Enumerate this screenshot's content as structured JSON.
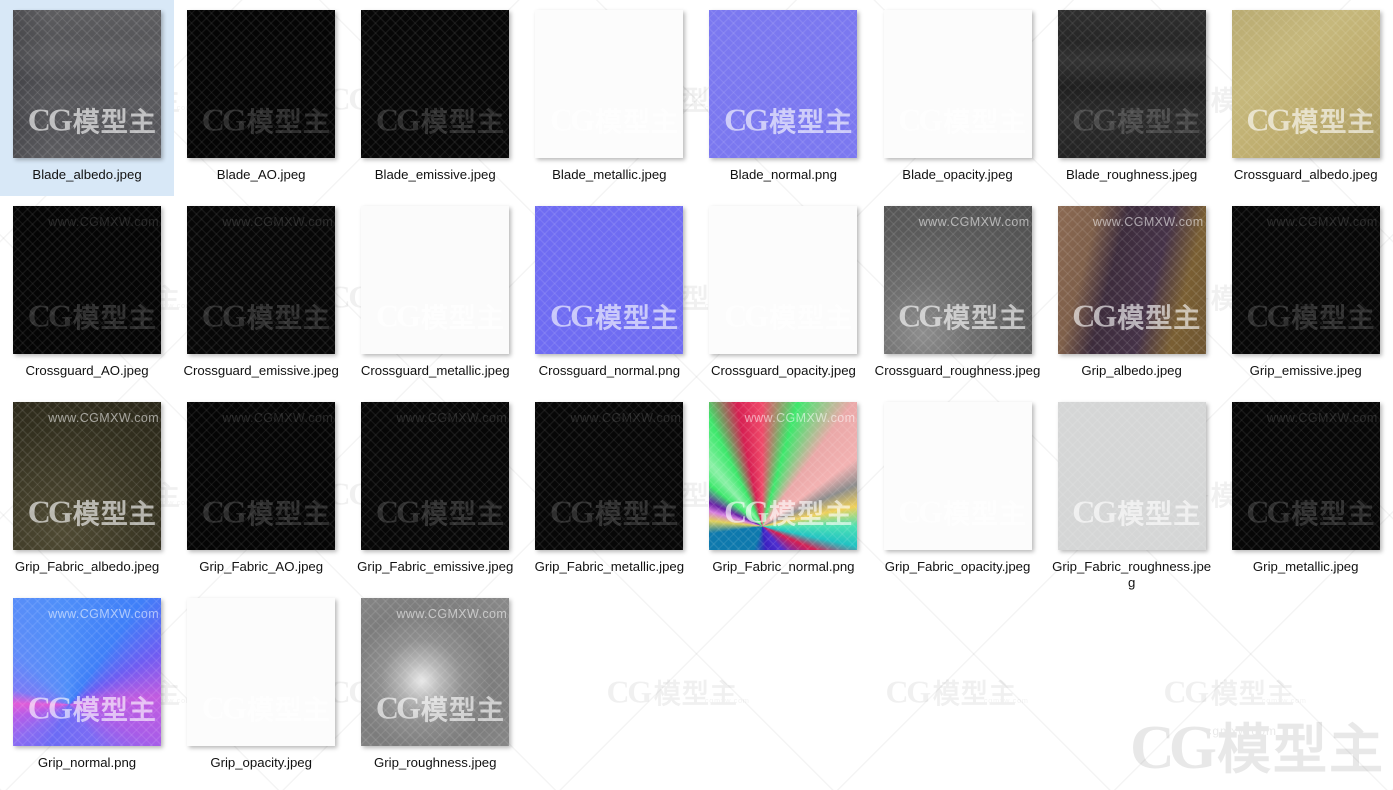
{
  "watermark": {
    "logo_cg": "CG",
    "logo_cn": "模型主",
    "domain_small": "cgmxw.com",
    "url_text": "www.CGMXW.com"
  },
  "view": {
    "mode": "thumbnail-grid",
    "columns": 8,
    "selected_index": 0,
    "item_count": 27,
    "selection_color": "#d8e8f7"
  },
  "files": [
    {
      "name": "Blade_albedo.jpeg",
      "selected": true,
      "thumb": "blade-albedo",
      "wm_dark": false,
      "show_url": false
    },
    {
      "name": "Blade_AO.jpeg",
      "selected": false,
      "thumb": "blade-ao",
      "wm_dark": true,
      "show_url": false
    },
    {
      "name": "Blade_emissive.jpeg",
      "selected": false,
      "thumb": "black",
      "wm_dark": true,
      "show_url": false
    },
    {
      "name": "Blade_metallic.jpeg",
      "selected": false,
      "thumb": "white",
      "wm_dark": false,
      "show_url": false
    },
    {
      "name": "Blade_normal.png",
      "selected": false,
      "thumb": "blade-normal",
      "wm_dark": false,
      "show_url": false
    },
    {
      "name": "Blade_opacity.jpeg",
      "selected": false,
      "thumb": "white",
      "wm_dark": false,
      "show_url": false
    },
    {
      "name": "Blade_roughness.jpeg",
      "selected": false,
      "thumb": "blade-roughness",
      "wm_dark": true,
      "show_url": false
    },
    {
      "name": "Crossguard_albedo.jpeg",
      "selected": false,
      "thumb": "crossguard-albedo",
      "wm_dark": false,
      "show_url": false
    },
    {
      "name": "Crossguard_AO.jpeg",
      "selected": false,
      "thumb": "crossguard-ao",
      "wm_dark": true,
      "show_url": true
    },
    {
      "name": "Crossguard_emissive.jpeg",
      "selected": false,
      "thumb": "black",
      "wm_dark": true,
      "show_url": true
    },
    {
      "name": "Crossguard_metallic.jpeg",
      "selected": false,
      "thumb": "crossguard-metallic",
      "wm_dark": false,
      "show_url": false
    },
    {
      "name": "Crossguard_normal.png",
      "selected": false,
      "thumb": "crossguard-normal",
      "wm_dark": false,
      "show_url": false
    },
    {
      "name": "Crossguard_opacity.jpeg",
      "selected": false,
      "thumb": "white",
      "wm_dark": false,
      "show_url": false
    },
    {
      "name": "Crossguard_roughness.jpeg",
      "selected": false,
      "thumb": "crossguard-roughness",
      "wm_dark": false,
      "show_url": true
    },
    {
      "name": "Grip_albedo.jpeg",
      "selected": false,
      "thumb": "grip-albedo",
      "wm_dark": false,
      "show_url": true
    },
    {
      "name": "Grip_emissive.jpeg",
      "selected": false,
      "thumb": "black",
      "wm_dark": true,
      "show_url": true
    },
    {
      "name": "Grip_Fabric_albedo.jpeg",
      "selected": false,
      "thumb": "grip-fabric-albedo",
      "wm_dark": false,
      "show_url": true
    },
    {
      "name": "Grip_Fabric_AO.jpeg",
      "selected": false,
      "thumb": "grip-fabric-ao",
      "wm_dark": true,
      "show_url": true
    },
    {
      "name": "Grip_Fabric_emissive.jpeg",
      "selected": false,
      "thumb": "black",
      "wm_dark": true,
      "show_url": true
    },
    {
      "name": "Grip_Fabric_metallic.jpeg",
      "selected": false,
      "thumb": "black",
      "wm_dark": true,
      "show_url": true
    },
    {
      "name": "Grip_Fabric_normal.png",
      "selected": false,
      "thumb": "grip-fabric-normal",
      "wm_dark": false,
      "show_url": true
    },
    {
      "name": "Grip_Fabric_opacity.jpeg",
      "selected": false,
      "thumb": "white",
      "wm_dark": false,
      "show_url": false
    },
    {
      "name": "Grip_Fabric_roughness.jpeg",
      "selected": false,
      "thumb": "grip-fabric-roughness",
      "wm_dark": false,
      "show_url": false
    },
    {
      "name": "Grip_metallic.jpeg",
      "selected": false,
      "thumb": "black",
      "wm_dark": true,
      "show_url": true
    },
    {
      "name": "Grip_normal.png",
      "selected": false,
      "thumb": "grip-normal",
      "wm_dark": false,
      "show_url": true
    },
    {
      "name": "Grip_opacity.jpeg",
      "selected": false,
      "thumb": "white",
      "wm_dark": false,
      "show_url": false
    },
    {
      "name": "Grip_roughness.jpeg",
      "selected": false,
      "thumb": "grip-roughness",
      "wm_dark": false,
      "show_url": true
    }
  ]
}
